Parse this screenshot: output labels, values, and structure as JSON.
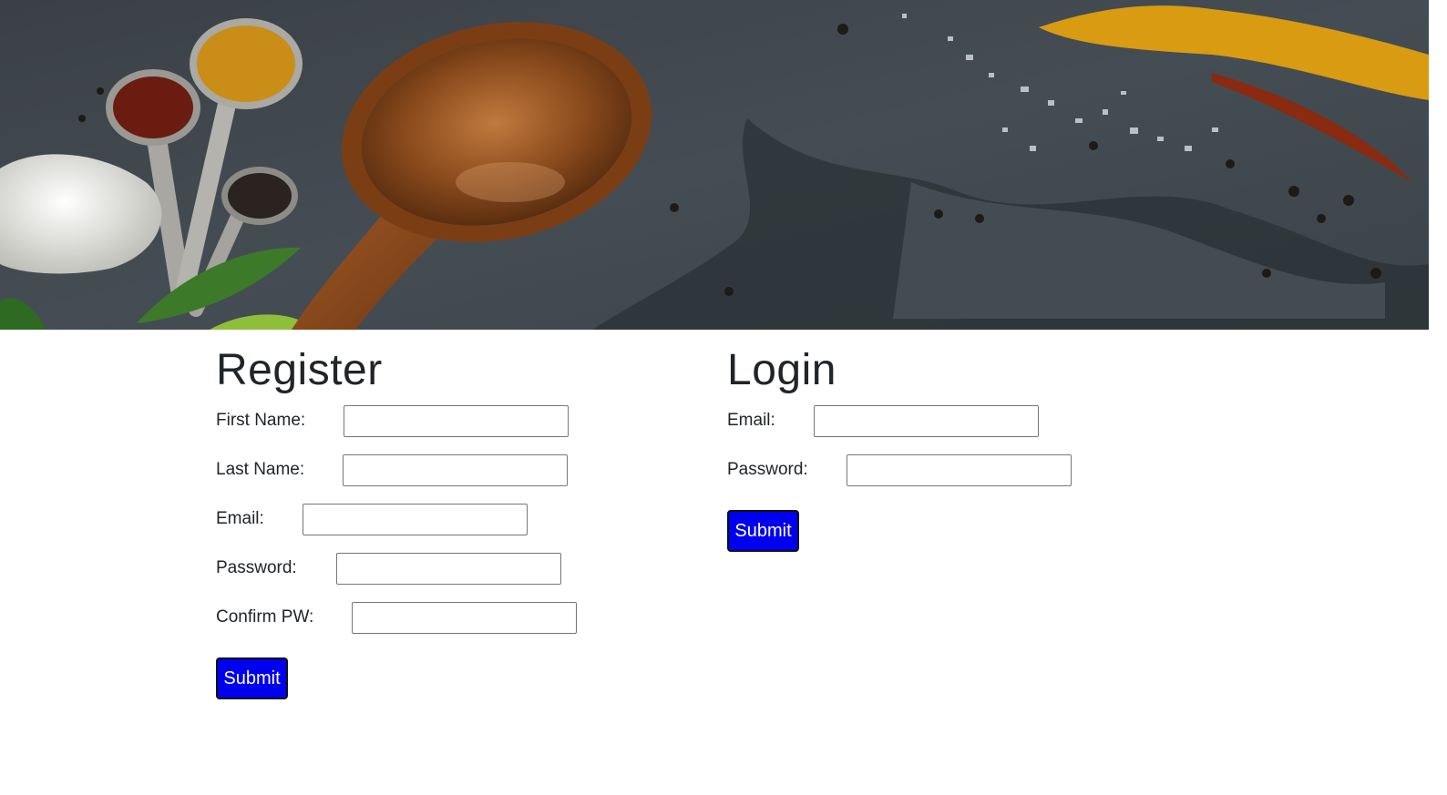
{
  "banner": {
    "alt": "spices and wooden spoon banner"
  },
  "register": {
    "title": "Register",
    "fields": [
      {
        "label": "First Name:",
        "value": "",
        "name": "first-name"
      },
      {
        "label": "Last Name:",
        "value": "",
        "name": "last-name"
      },
      {
        "label": "Email:",
        "value": "",
        "name": "email"
      },
      {
        "label": "Password:",
        "value": "",
        "name": "password"
      },
      {
        "label": "Confirm PW:",
        "value": "",
        "name": "confirm-pw"
      }
    ],
    "submit_label": "Submit"
  },
  "login": {
    "title": "Login",
    "fields": [
      {
        "label": "Email:",
        "value": "",
        "name": "email"
      },
      {
        "label": "Password:",
        "value": "",
        "name": "password"
      }
    ],
    "submit_label": "Submit"
  },
  "colors": {
    "button_bg": "#0000f0",
    "button_text": "#ffffff",
    "text": "#212529"
  }
}
